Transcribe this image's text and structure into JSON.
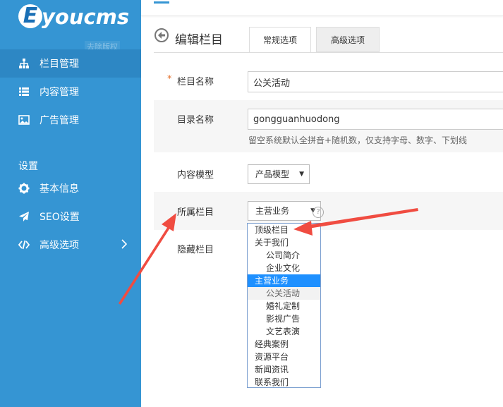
{
  "logo": {
    "letter": "E",
    "text": "youcms",
    "ghost": "去除版权"
  },
  "sidebar": {
    "items": [
      {
        "label": "栏目管理",
        "icon": "sitemap-icon",
        "active": true
      },
      {
        "label": "内容管理",
        "icon": "list-icon"
      },
      {
        "label": "广告管理",
        "icon": "image-icon"
      }
    ],
    "settings_heading": "设置",
    "settings_items": [
      {
        "label": "基本信息",
        "icon": "gear-icon"
      },
      {
        "label": "SEO设置",
        "icon": "paper-plane-icon"
      },
      {
        "label": "高级选项",
        "icon": "code-icon"
      }
    ]
  },
  "page": {
    "title": "编辑栏目",
    "tabs": [
      "常规选项",
      "高级选项"
    ]
  },
  "form": {
    "required_mark": "*",
    "name_label": "栏目名称",
    "name_value": "公关活动",
    "dir_label": "目录名称",
    "dir_value": "gongguanhuodong",
    "dir_hint": "留空系统默认全拼音+随机数，仅支持字母、数字、下划线",
    "model_label": "内容模型",
    "model_value": "产品模型",
    "parent_label": "所属栏目",
    "parent_value": "主营业务",
    "hidden_label": "隐藏栏目",
    "help_mark": "?"
  },
  "dropdown": {
    "options": [
      {
        "label": "顶级栏目",
        "level": 1
      },
      {
        "label": "关于我们",
        "level": 1
      },
      {
        "label": "公司简介",
        "level": 2
      },
      {
        "label": "企业文化",
        "level": 2
      },
      {
        "label": "主营业务",
        "level": 1,
        "selected": true
      },
      {
        "label": "公关活动",
        "level": 2,
        "current": true
      },
      {
        "label": "婚礼定制",
        "level": 2
      },
      {
        "label": "影视广告",
        "level": 2
      },
      {
        "label": "文艺表演",
        "level": 2
      },
      {
        "label": "经典案例",
        "level": 1
      },
      {
        "label": "资源平台",
        "level": 1
      },
      {
        "label": "新闻资讯",
        "level": 1
      },
      {
        "label": "联系我们",
        "level": 1
      }
    ]
  },
  "colors": {
    "sidebar": "#3595d3",
    "sidebar_active": "#2d87c4",
    "highlight": "#1e90ff",
    "annotation_arrow": "#f04c41"
  }
}
